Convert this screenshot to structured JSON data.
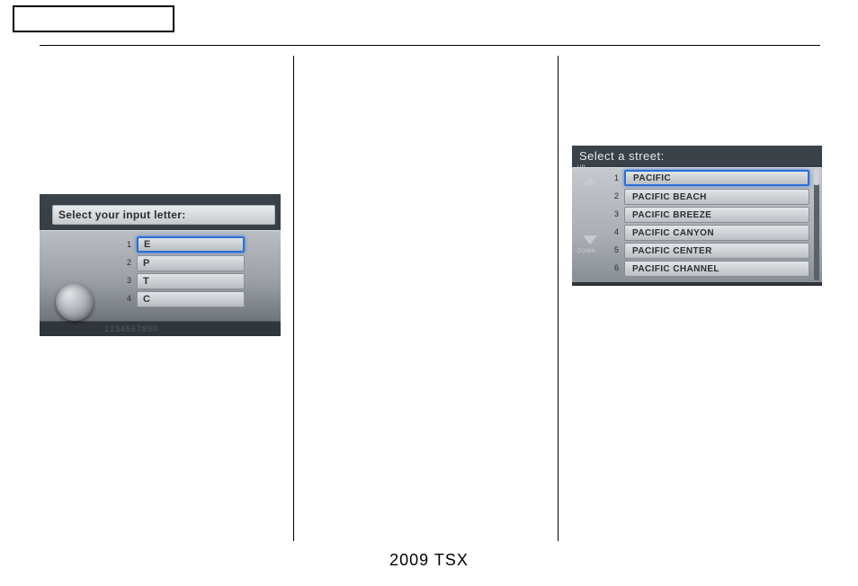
{
  "footer": "2009 TSX",
  "screen1": {
    "title": "Select your input letter:",
    "rows": [
      {
        "num": "1",
        "letter": "E"
      },
      {
        "num": "2",
        "letter": "P"
      },
      {
        "num": "3",
        "letter": "T"
      },
      {
        "num": "4",
        "letter": "C"
      }
    ],
    "bottom_numbers": "1234567890"
  },
  "screen2": {
    "title": "Select a street:",
    "up_label": "UP",
    "down_label": "DOWN",
    "rows": [
      {
        "num": "1",
        "name": "PACIFIC"
      },
      {
        "num": "2",
        "name": "PACIFIC BEACH"
      },
      {
        "num": "3",
        "name": "PACIFIC BREEZE"
      },
      {
        "num": "4",
        "name": "PACIFIC CANYON"
      },
      {
        "num": "5",
        "name": "PACIFIC CENTER"
      },
      {
        "num": "6",
        "name": "PACIFIC CHANNEL"
      }
    ]
  }
}
